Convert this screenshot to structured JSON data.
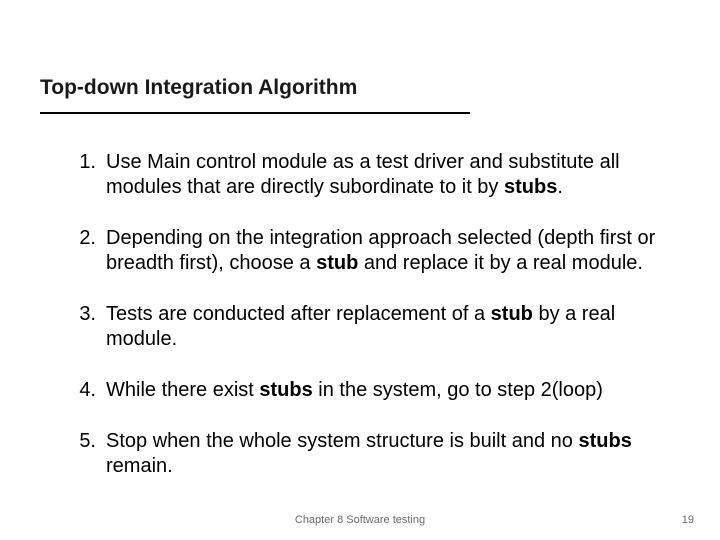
{
  "title": "Top-down Integration Algorithm",
  "items": [
    {
      "num": "1.",
      "html": "Use Main control module as a test driver and substitute all modules that are directly subordinate to it by <b>stubs</b>."
    },
    {
      "num": "2.",
      "html": "Depending on the integration approach selected (depth first or breadth first), choose a <b>stub</b> and replace it by a real module."
    },
    {
      "num": "3.",
      "html": "Tests are conducted after replacement of a <b>stub</b> by a real module."
    },
    {
      "num": "4.",
      "html": "While there exist <b>stubs</b> in the system, go to step 2(loop)"
    },
    {
      "num": "5.",
      "html": "Stop when the whole system structure is built and no <b>stubs</b> remain."
    }
  ],
  "footer": {
    "center": "Chapter 8 Software testing",
    "page": "19"
  }
}
